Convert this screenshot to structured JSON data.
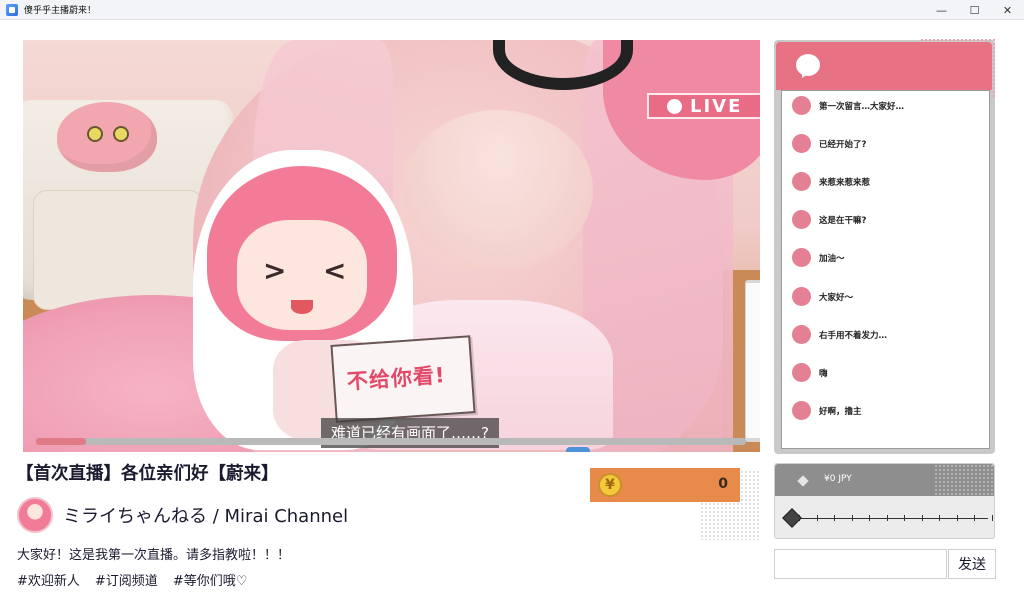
{
  "window": {
    "title": "傻乎乎主播蔚来！",
    "minimize": "—",
    "maximize": "☐",
    "close": "✕"
  },
  "video": {
    "live_label": "LIVE",
    "sign_text": "不给你看!",
    "subtitle": "难道已经有画面了……?",
    "alert_icon": "!",
    "progress_fraction": 0.07
  },
  "stream": {
    "title": "【首次直播】各位亲们好【蔚来】",
    "channel_name": "ミライちゃんねる / Mirai Channel",
    "description": "大家好！这是我第一次直播。请多指教啦！！！",
    "tags": [
      "#欢迎新人",
      "#订阅频道",
      "#等你们哦♡"
    ]
  },
  "coins": {
    "icon": "¥",
    "count": "0"
  },
  "chat": {
    "icon": "speech-bubble-icon",
    "messages": [
      "第一次留言…大家好…",
      "已经开始了?",
      "来惹来惹来惹",
      "这是在干嘛?",
      "加油〜",
      "大家好〜",
      "右手用不着发力…",
      "嗨",
      "好啊，撸主"
    ]
  },
  "gift": {
    "amount_label": "¥0 JPY",
    "slider_value": 0
  },
  "input": {
    "placeholder": "",
    "send_label": "发送"
  },
  "colors": {
    "accent_pink": "#e67284",
    "coin_orange": "#e88b4a"
  }
}
